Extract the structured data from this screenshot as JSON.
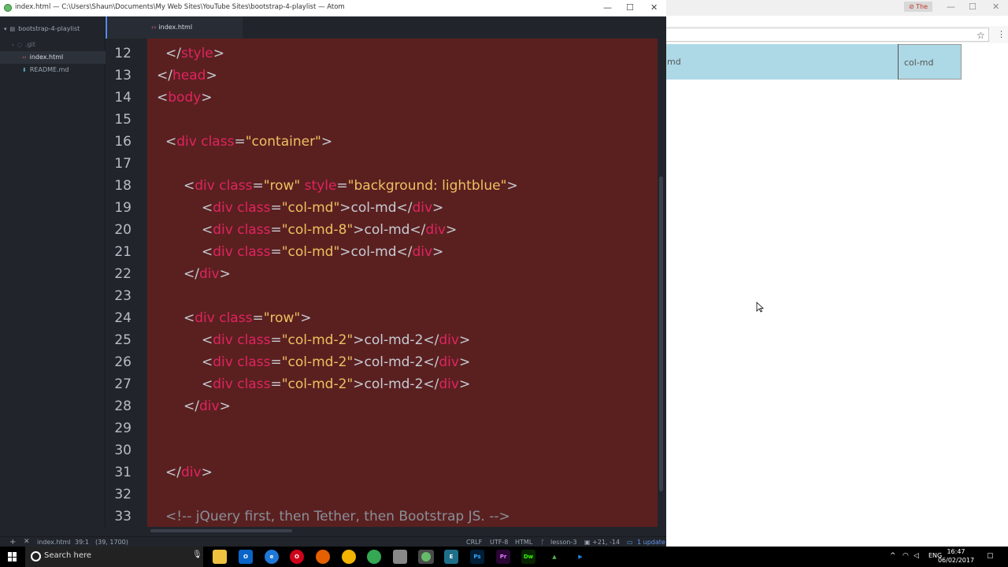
{
  "atom": {
    "window_title": "index.html — C:\\Users\\Shaun\\Documents\\My Web Sites\\YouTube Sites\\bootstrap-4-playlist — Atom",
    "tree": {
      "project": "bootstrap-4-playlist",
      "items": [
        ".git",
        "index.html",
        "README.md"
      ]
    },
    "tab": "index.html",
    "line_numbers": [
      "12",
      "13",
      "14",
      "15",
      "16",
      "17",
      "18",
      "19",
      "20",
      "21",
      "22",
      "23",
      "24",
      "25",
      "26",
      "27",
      "28",
      "29",
      "30",
      "31",
      "32",
      "33"
    ],
    "code": {
      "l12": [
        "</",
        "style",
        ">"
      ],
      "l13": [
        "</",
        "head",
        ">"
      ],
      "l14": [
        "<",
        "body",
        ">"
      ],
      "l16": [
        "<",
        "div",
        " ",
        "class",
        "=",
        "\"container\"",
        ">"
      ],
      "l18": [
        "<",
        "div",
        " ",
        "class",
        "=",
        "\"row\"",
        " ",
        "style",
        "=",
        "\"background: lightblue\"",
        ">"
      ],
      "l19": [
        "<",
        "div",
        " ",
        "class",
        "=",
        "\"col-md\"",
        ">col-md</",
        "div",
        ">"
      ],
      "l20": [
        "<",
        "div",
        " ",
        "class",
        "=",
        "\"col-md-8\"",
        ">col-md</",
        "div",
        ">"
      ],
      "l21": [
        "<",
        "div",
        " ",
        "class",
        "=",
        "\"col-md\"",
        ">col-md</",
        "div",
        ">"
      ],
      "l22": [
        "</",
        "div",
        ">"
      ],
      "l24": [
        "<",
        "div",
        " ",
        "class",
        "=",
        "\"row\"",
        ">"
      ],
      "l25": [
        "<",
        "div",
        " ",
        "class",
        "=",
        "\"col-md-2\"",
        ">col-md-2</",
        "div",
        ">"
      ],
      "l26": [
        "<",
        "div",
        " ",
        "class",
        "=",
        "\"col-md-2\"",
        ">col-md-2</",
        "div",
        ">"
      ],
      "l27": [
        "<",
        "div",
        " ",
        "class",
        "=",
        "\"col-md-2\"",
        ">col-md-2</",
        "div",
        ">"
      ],
      "l28": [
        "</",
        "div",
        ">"
      ],
      "l31": [
        "</",
        "div",
        ">"
      ],
      "l33": "<!-- jQuery first, then Tether, then Bootstrap JS. -->"
    },
    "status": {
      "file": "index.html",
      "cursor": "39:1",
      "selection": "(39, 1700)",
      "line_ending": "CRLF",
      "encoding": "UTF-8",
      "grammar": "HTML",
      "branch": "lesson-3",
      "diff": "+21, -14",
      "updates": "1 update"
    },
    "colors": {
      "editor_bg": "#5a2020",
      "tag": "#e0245e",
      "string": "#f0c060",
      "text": "#c8ccd4",
      "comment": "#8a8f98"
    }
  },
  "browser": {
    "user_badge": "⊘ The",
    "col_a": "md",
    "col_b": "col-md",
    "row_bg": "#add8e6"
  },
  "taskbar": {
    "search_placeholder": "Search here",
    "language": "ENG",
    "time": "16:47",
    "date": "06/02/2017",
    "apps": [
      "file-explorer",
      "outlook",
      "edge",
      "opera",
      "firefox",
      "chrome-canary",
      "chrome",
      "app-8",
      "atom",
      "app-10",
      "photoshop",
      "premiere",
      "dreamweaver",
      "app-14",
      "app-15"
    ]
  }
}
